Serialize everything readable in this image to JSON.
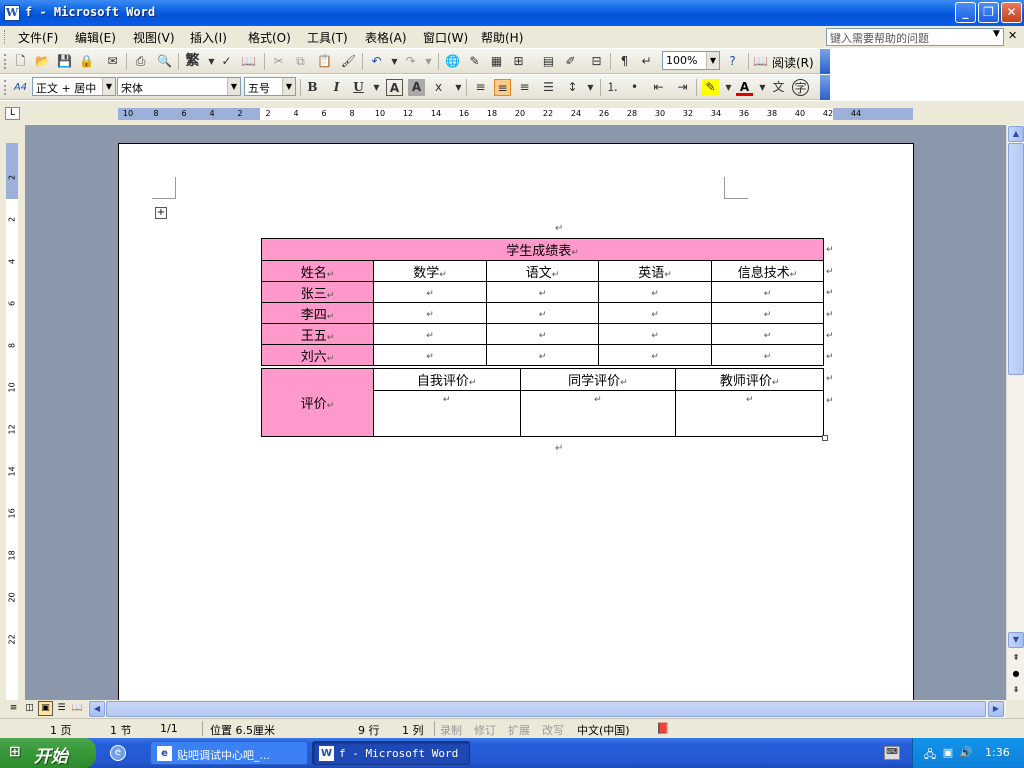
{
  "window": {
    "app_icon": "W",
    "title": "f - Microsoft Word",
    "min": "_",
    "max": "❐",
    "close": "✕"
  },
  "menu": {
    "items": [
      "文件(F)",
      "编辑(E)",
      "视图(V)",
      "插入(I)",
      "格式(O)",
      "工具(T)",
      "表格(A)",
      "窗口(W)",
      "帮助(H)"
    ],
    "help_placeholder": "键入需要帮助的问题"
  },
  "toolbar": {
    "zoom": "100%",
    "read_label": "阅读(R)",
    "style": "正文 + 居中",
    "font": "宋体",
    "size": "五号",
    "bold": "B",
    "italic": "I",
    "underline": "U",
    "trad_char": "繁",
    "style_icon": "A4"
  },
  "ruler": {
    "h_labels": [
      "10",
      "8",
      "6",
      "4",
      "2",
      "2",
      "4",
      "6",
      "8",
      "10",
      "12",
      "14",
      "16",
      "18",
      "20",
      "22",
      "24",
      "26",
      "28",
      "30",
      "32",
      "34",
      "36",
      "38",
      "40",
      "42",
      "44"
    ],
    "v_labels": [
      "2",
      "2",
      "4",
      "6",
      "8",
      "10",
      "12",
      "14",
      "16",
      "18",
      "20",
      "22"
    ],
    "corner": "L"
  },
  "table": {
    "title": "学生成绩表",
    "headers": [
      "姓名",
      "数学",
      "语文",
      "英语",
      "信息技术"
    ],
    "students": [
      "张三",
      "李四",
      "王五",
      "刘六"
    ],
    "eval_label": "评价",
    "eval_headers": [
      "自我评价",
      "同学评价",
      "教师评价"
    ],
    "para_mark": "↵"
  },
  "status": {
    "page": "1 页",
    "section": "1 节",
    "page_of": "1/1",
    "position": "位置 6.5厘米",
    "line": "9 行",
    "col": "1 列",
    "rec": "录制",
    "trk": "修订",
    "ext": "扩展",
    "ovr": "改写",
    "lang": "中文(中国)"
  },
  "taskbar": {
    "start": "开始",
    "task1": "贴吧调试中心吧_...",
    "task2": "f - Microsoft Word",
    "clock": "1:36"
  }
}
